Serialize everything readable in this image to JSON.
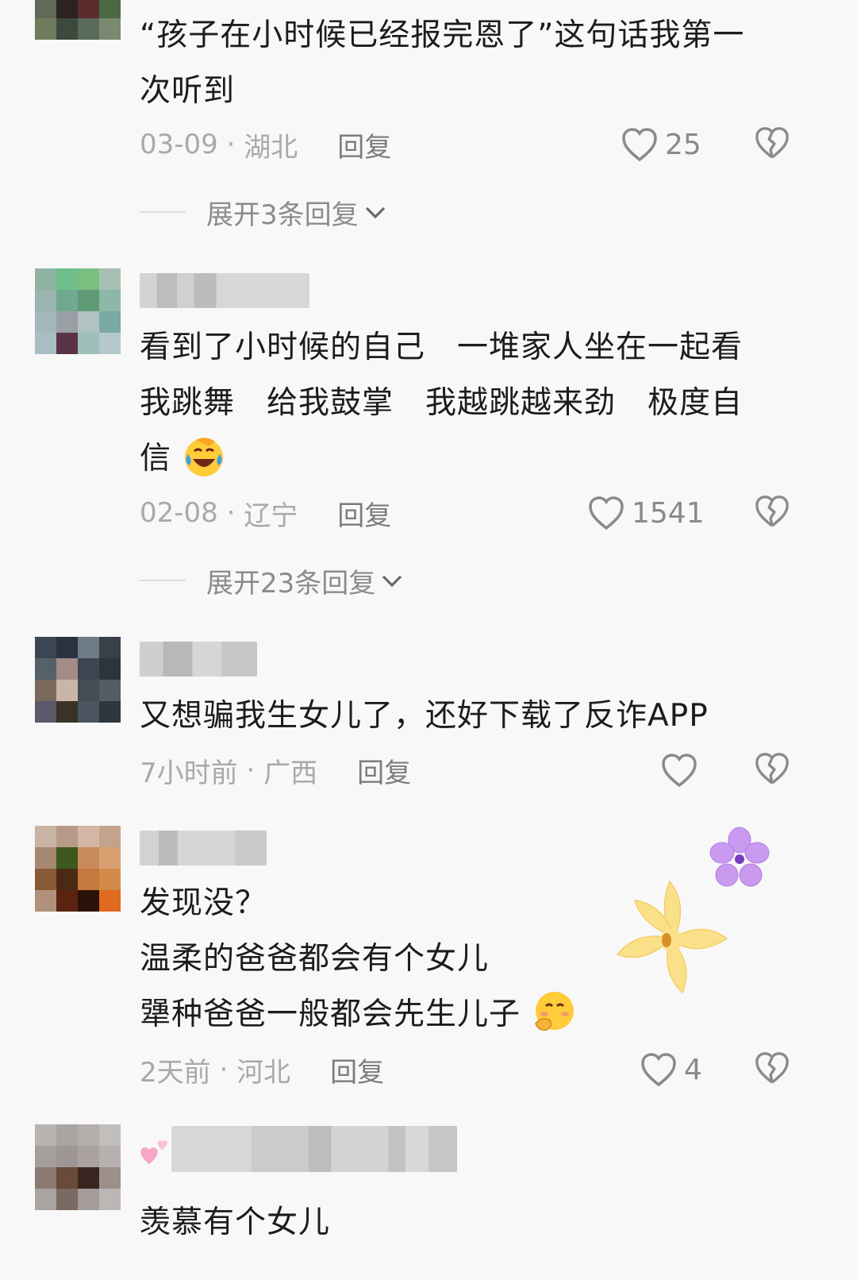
{
  "comments": [
    {
      "text_lines": [
        "“孩子在小时候已经报完恩了”这句话我第一",
        "次听到"
      ],
      "date": "03-09",
      "location": "湖北",
      "reply_label": "回复",
      "likes": "25",
      "expand_label": "展开3条回复"
    },
    {
      "text_lines": [
        "看到了小时候的自己　一堆家人坐在一起看",
        "我跳舞　给我鼓掌　我越跳越来劲　极度自",
        "信"
      ],
      "emoji": "laughing-crying-emoji",
      "date": "02-08",
      "location": "辽宁",
      "reply_label": "回复",
      "likes": "1541",
      "expand_label": "展开23条回复"
    },
    {
      "text_lines": [
        "又想骗我生女儿了，还好下载了反诈APP"
      ],
      "date": "7小时前",
      "location": "广西",
      "reply_label": "回复",
      "likes": ""
    },
    {
      "text_lines": [
        "发现没？",
        "温柔的爸爸都会有个女儿",
        "犟种爸爸一般都会先生儿子"
      ],
      "emoji": "shy-smile-emoji",
      "date": "2天前",
      "location": "河北",
      "reply_label": "回复",
      "likes": "4"
    },
    {
      "text_lines": [
        "羡慕有个女儿"
      ]
    }
  ],
  "separator": " · ",
  "colors": {
    "background": "#f8f8f8",
    "text": "#1c1c1c",
    "meta": "#a9a9a9",
    "icon": "#8a8a8a"
  }
}
